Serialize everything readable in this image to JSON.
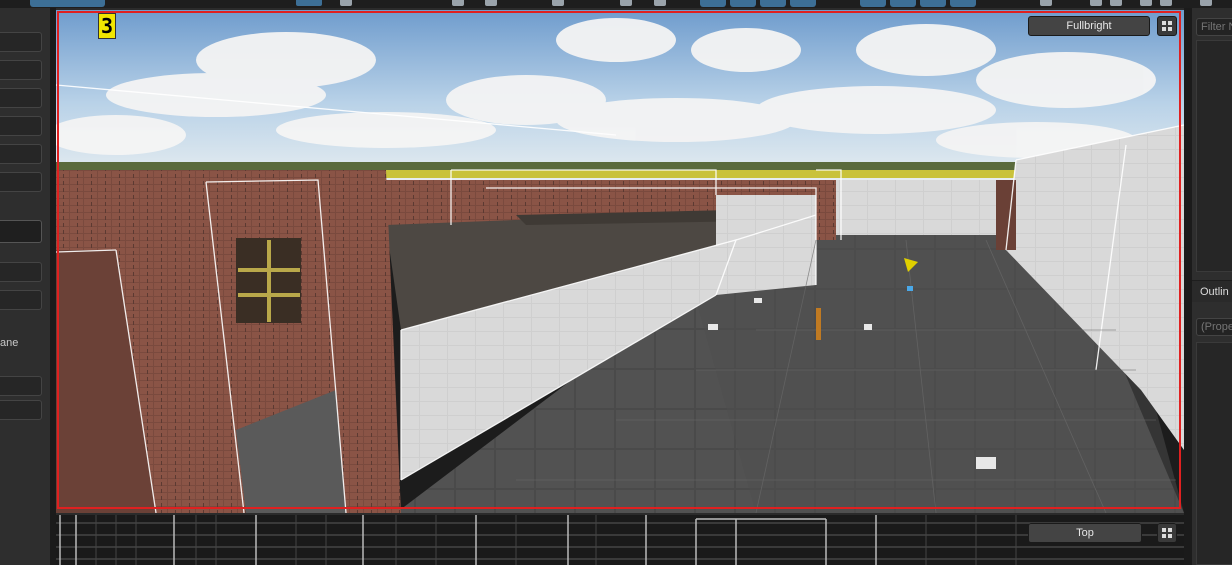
{
  "viewport": {
    "marker": "3",
    "mode_label": "Fullbright"
  },
  "topview": {
    "mode_label": "Top"
  },
  "left_panel": {
    "selected_option": "ane"
  },
  "right_panel": {
    "filter_placeholder": "Filter N",
    "outliner_tab": "Outlin",
    "properties_placeholder": "(Prope"
  },
  "colors": {
    "selection_border": "#e02020",
    "marker_bg": "#f2e600",
    "toolbar_accent": "#3d6f96"
  },
  "icons": [
    "grid-layout-icon",
    "sun-light-icon",
    "player-start-icon"
  ]
}
